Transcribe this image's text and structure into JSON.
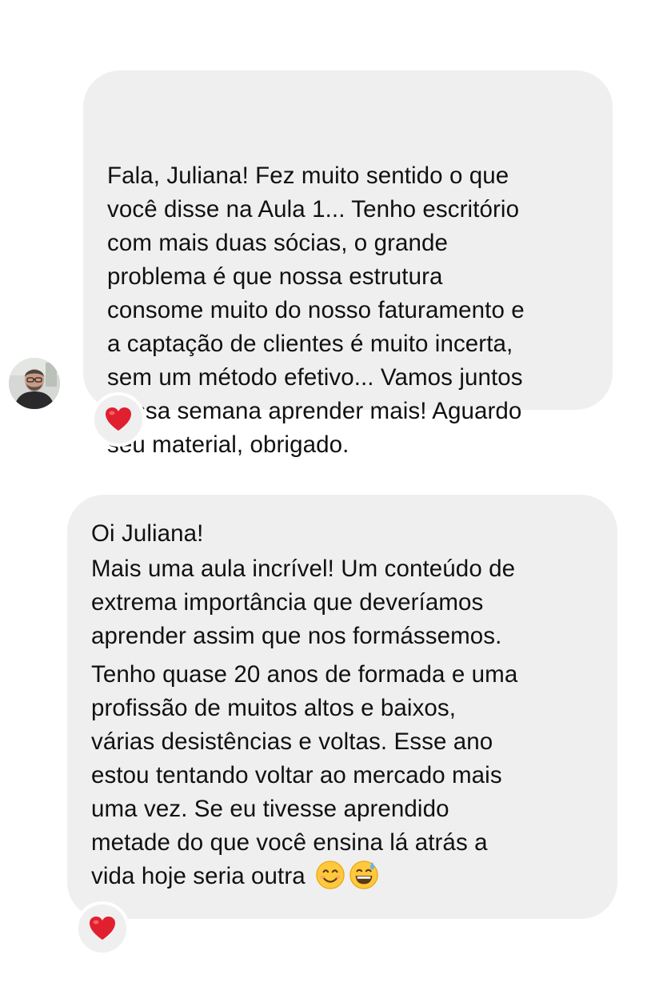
{
  "messages": [
    {
      "lines": [
        "Fala, Juliana! Fez muito sentido o que",
        "você disse na Aula 1... Tenho escritório",
        "com mais duas sócias, o grande",
        "problema é que nossa estrutura",
        "consome muito do nosso faturamento e",
        "a captação de clientes é muito incerta,",
        "sem um método efetivo... Vamos juntos",
        "nessa semana aprender mais! Aguardo",
        "seu material, obrigado."
      ],
      "reaction": "heart-icon"
    },
    {
      "paragraphs": [
        {
          "lines": [
            "Oi Juliana!"
          ]
        },
        {
          "lines": [
            "Mais uma aula incrível! Um conteúdo de",
            "extrema importância que deveríamos",
            "aprender assim que nos formássemos."
          ]
        },
        {
          "lines": [
            "Tenho quase 20 anos de formada e uma",
            "profissão de muitos altos e baixos,",
            "várias desistências e voltas. Esse ano",
            "estou tentando voltar ao mercado mais",
            "uma vez. Se eu tivesse aprendido",
            "metade do que você ensina lá atrás a",
            "vida hoje seria outra"
          ]
        }
      ],
      "emojis": [
        "smiling-face-emoji",
        "grinning-sweat-emoji"
      ],
      "reaction": "heart-icon"
    }
  ],
  "colors": {
    "bubble": "#efeff0",
    "heart": "#e0202f",
    "text": "#111111"
  }
}
